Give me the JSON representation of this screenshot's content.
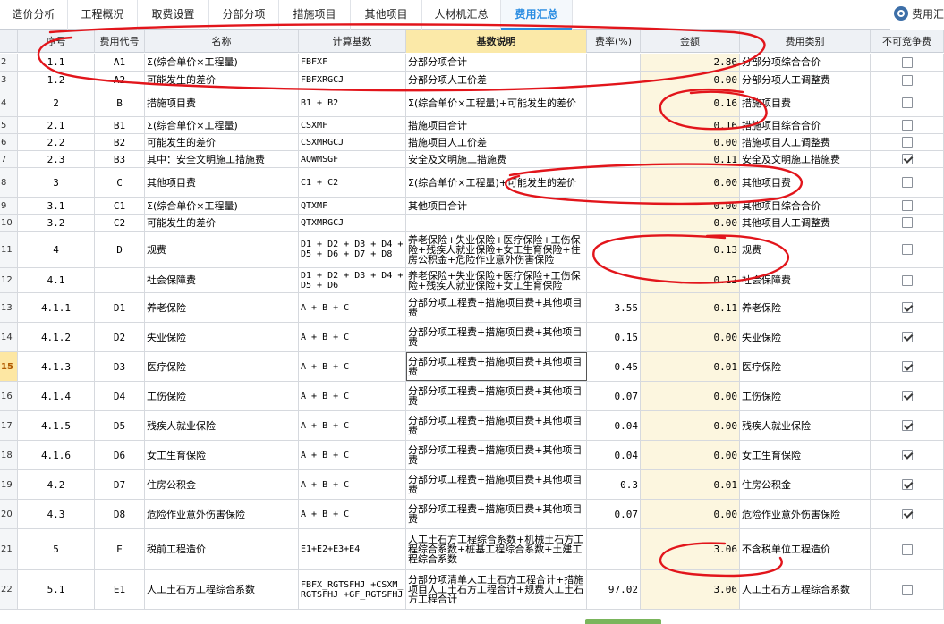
{
  "tabs": [
    {
      "label": "造价分析"
    },
    {
      "label": "工程概况"
    },
    {
      "label": "取费设置"
    },
    {
      "label": "分部分项"
    },
    {
      "label": "措施项目"
    },
    {
      "label": "其他项目"
    },
    {
      "label": "人材机汇总"
    },
    {
      "label": "费用汇总",
      "active": true
    }
  ],
  "right_button": {
    "label": "费用汇",
    "icon": "settings-icon"
  },
  "columns": {
    "seq": "序号",
    "code": "费用代号",
    "name": "名称",
    "base": "计算基数",
    "desc": "基数说明",
    "rate": "费率(%)",
    "amount": "金额",
    "type": "费用类别",
    "noncompete": "不可竞争费"
  },
  "rows": [
    {
      "rn": "2",
      "seq": "1.1",
      "code": "A1",
      "name": "Σ(综合单价×工程量)",
      "base": "FBFXF",
      "desc": "分部分项合计",
      "rate": "",
      "amount": "2.86",
      "type": "分部分项综合合价",
      "chk": false
    },
    {
      "rn": "3",
      "seq": "1.2",
      "code": "A2",
      "name": "可能发生的差价",
      "base": "FBFXRGCJ",
      "desc": "分部分项人工价差",
      "rate": "",
      "amount": "0.00",
      "type": "分部分项人工调整费",
      "chk": false
    },
    {
      "rn": "4",
      "seq": "2",
      "code": "B",
      "name": "措施项目费",
      "base": "B1 + B2",
      "desc": "Σ(综合单价×工程量)+可能发生的差价",
      "rate": "",
      "amount": "0.16",
      "type": "措施项目费",
      "chk": false
    },
    {
      "rn": "5",
      "seq": "2.1",
      "code": "B1",
      "name": "Σ(综合单价×工程量)",
      "base": "CSXMF",
      "desc": "措施项目合计",
      "rate": "",
      "amount": "0.16",
      "type": "措施项目综合合价",
      "chk": false
    },
    {
      "rn": "6",
      "seq": "2.2",
      "code": "B2",
      "name": "可能发生的差价",
      "base": "CSXMRGCJ",
      "desc": "措施项目人工价差",
      "rate": "",
      "amount": "0.00",
      "type": "措施项目人工调整费",
      "chk": false
    },
    {
      "rn": "7",
      "seq": "2.3",
      "code": "B3",
      "name": "其中：安全文明施工措施费",
      "base": "AQWMSGF",
      "desc": "安全及文明施工措施费",
      "rate": "",
      "amount": "0.11",
      "type": "安全及文明施工措施费",
      "chk": true
    },
    {
      "rn": "8",
      "seq": "3",
      "code": "C",
      "name": "其他项目费",
      "base": "C1 + C2",
      "desc": "Σ(综合单价×工程量)+可能发生的差价",
      "rate": "",
      "amount": "0.00",
      "type": "其他项目费",
      "chk": false
    },
    {
      "rn": "9",
      "seq": "3.1",
      "code": "C1",
      "name": "Σ(综合单价×工程量)",
      "base": "QTXMF",
      "desc": "其他项目合计",
      "rate": "",
      "amount": "0.00",
      "type": "其他项目综合合价",
      "chk": false
    },
    {
      "rn": "10",
      "seq": "3.2",
      "code": "C2",
      "name": "可能发生的差价",
      "base": "QTXMRGCJ",
      "desc": "",
      "rate": "",
      "amount": "0.00",
      "type": "其他项目人工调整费",
      "chk": false
    },
    {
      "rn": "11",
      "seq": "4",
      "code": "D",
      "name": "规费",
      "base": "D1 + D2 + D3 + D4 + D5 + D6 + D7 + D8",
      "desc": "养老保险+失业保险+医疗保险+工伤保险+残疾人就业保险+女工生育保险+住房公积金+危险作业意外伤害保险",
      "rate": "",
      "amount": "0.13",
      "type": "规费",
      "chk": false
    },
    {
      "rn": "12",
      "seq": "4.1",
      "code": "",
      "name": "社会保障费",
      "base": "D1 + D2 + D3 + D4 + D5 + D6",
      "desc": "养老保险+失业保险+医疗保险+工伤保险+残疾人就业保险+女工生育保险",
      "rate": "",
      "amount": "0.12",
      "type": "社会保障费",
      "chk": false
    },
    {
      "rn": "13",
      "seq": "4.1.1",
      "code": "D1",
      "name": "养老保险",
      "base": "A + B + C",
      "desc": "分部分项工程费+措施项目费+其他项目费",
      "rate": "3.55",
      "amount": "0.11",
      "type": "养老保险",
      "chk": true
    },
    {
      "rn": "14",
      "seq": "4.1.2",
      "code": "D2",
      "name": "失业保险",
      "base": "A + B + C",
      "desc": "分部分项工程费+措施项目费+其他项目费",
      "rate": "0.15",
      "amount": "0.00",
      "type": "失业保险",
      "chk": true
    },
    {
      "rn": "15",
      "seq": "4.1.3",
      "code": "D3",
      "name": "医疗保险",
      "base": "A + B + C",
      "desc": "分部分项工程费+措施项目费+其他项目费",
      "rate": "0.45",
      "amount": "0.01",
      "type": "医疗保险",
      "chk": true,
      "current": true
    },
    {
      "rn": "16",
      "seq": "4.1.4",
      "code": "D4",
      "name": "工伤保险",
      "base": "A + B + C",
      "desc": "分部分项工程费+措施项目费+其他项目费",
      "rate": "0.07",
      "amount": "0.00",
      "type": "工伤保险",
      "chk": true
    },
    {
      "rn": "17",
      "seq": "4.1.5",
      "code": "D5",
      "name": "残疾人就业保险",
      "base": "A + B + C",
      "desc": "分部分项工程费+措施项目费+其他项目费",
      "rate": "0.04",
      "amount": "0.00",
      "type": "残疾人就业保险",
      "chk": true
    },
    {
      "rn": "18",
      "seq": "4.1.6",
      "code": "D6",
      "name": "女工生育保险",
      "base": "A + B + C",
      "desc": "分部分项工程费+措施项目费+其他项目费",
      "rate": "0.04",
      "amount": "0.00",
      "type": "女工生育保险",
      "chk": true
    },
    {
      "rn": "19",
      "seq": "4.2",
      "code": "D7",
      "name": "住房公积金",
      "base": "A + B + C",
      "desc": "分部分项工程费+措施项目费+其他项目费",
      "rate": "0.3",
      "amount": "0.01",
      "type": "住房公积金",
      "chk": true
    },
    {
      "rn": "20",
      "seq": "4.3",
      "code": "D8",
      "name": "危险作业意外伤害保险",
      "base": "A + B + C",
      "desc": "分部分项工程费+措施项目费+其他项目费",
      "rate": "0.07",
      "amount": "0.00",
      "type": "危险作业意外伤害保险",
      "chk": true
    },
    {
      "rn": "21",
      "seq": "5",
      "code": "E",
      "name": "税前工程造价",
      "base": "E1+E2+E3+E4",
      "desc": "人工土石方工程综合系数+机械土石方工程综合系数+桩基工程综合系数+土建工程综合系数",
      "rate": "",
      "amount": "3.06",
      "type": "不含税单位工程造价",
      "chk": false
    },
    {
      "rn": "22",
      "seq": "5.1",
      "code": "E1",
      "name": "人工土石方工程综合系数",
      "base": "FBFX_RGTSFHJ +CSXM_RGTSFHJ +GF_RGTSFHJ",
      "desc": "分部分项清单人工土石方工程合计+措施项目人工土石方工程合计+规费人工土石方工程合计",
      "rate": "97.02",
      "amount": "3.06",
      "type": "人工土石方工程综合系数",
      "chk": false
    }
  ]
}
